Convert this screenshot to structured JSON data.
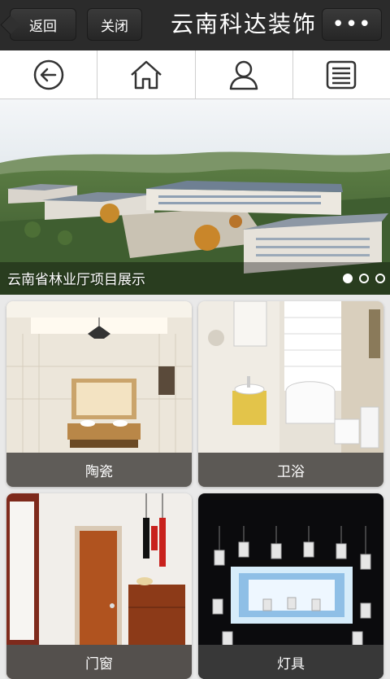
{
  "topbar": {
    "back_label": "返回",
    "close_label": "关闭",
    "title": "云南科达装饰",
    "more_label": "•••"
  },
  "navbar": {
    "items": [
      "back-icon",
      "home-icon",
      "user-icon",
      "menu-list-icon"
    ]
  },
  "banner": {
    "caption": "云南省林业厅项目展示",
    "slide_count": 3,
    "active_slide": 1
  },
  "tiles": [
    {
      "label": "陶瓷"
    },
    {
      "label": "卫浴"
    },
    {
      "label": "门窗"
    },
    {
      "label": "灯具"
    }
  ]
}
